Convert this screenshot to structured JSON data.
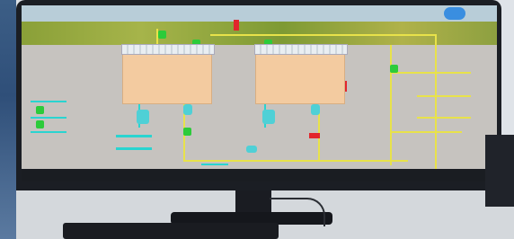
{
  "photo": {
    "description_free": true,
    "screen": {
      "title_text": "",
      "tanks": [
        {
          "label": "",
          "sublabel": ""
        },
        {
          "label": "",
          "sublabel": ""
        }
      ]
    }
  }
}
